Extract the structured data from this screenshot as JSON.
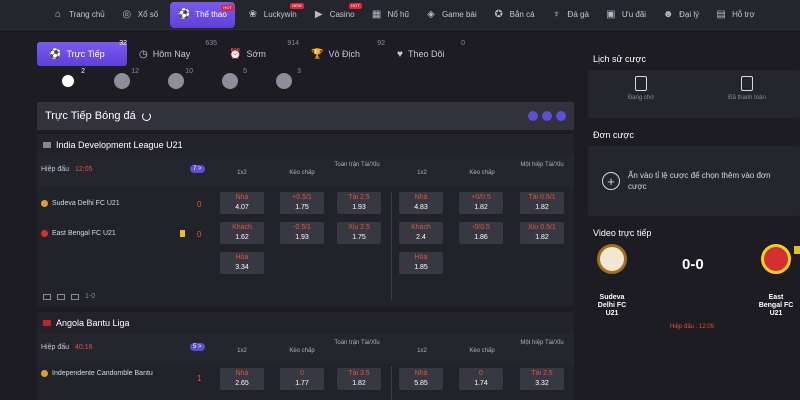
{
  "nav": [
    {
      "label": "Trang chủ",
      "icon": "home-icon",
      "glyph": "⌂"
    },
    {
      "label": "Xổ số",
      "icon": "lottery-icon",
      "glyph": "◎"
    },
    {
      "label": "Thể thao",
      "icon": "sports-icon",
      "glyph": "⚽",
      "hot": "HOT"
    },
    {
      "label": "Luckywin",
      "icon": "luckywin-icon",
      "glyph": "❀",
      "hot": "NEW"
    },
    {
      "label": "Casino",
      "icon": "casino-icon",
      "glyph": "▶",
      "hot": "HOT"
    },
    {
      "label": "Nổ hũ",
      "icon": "slots-icon",
      "glyph": "▦"
    },
    {
      "label": "Game bài",
      "icon": "cards-icon",
      "glyph": "◈"
    },
    {
      "label": "Bắn cá",
      "icon": "fish-icon",
      "glyph": "✪"
    },
    {
      "label": "Đá gà",
      "icon": "cockfight-icon",
      "glyph": "♆"
    },
    {
      "label": "Ưu đãi",
      "icon": "gift-icon",
      "glyph": "▣"
    },
    {
      "label": "Đại lý",
      "icon": "agent-icon",
      "glyph": "☻"
    },
    {
      "label": "Hỗ trợ",
      "icon": "support-icon",
      "glyph": "▤"
    }
  ],
  "tabs": [
    {
      "label": "Trực Tiếp",
      "count": "32",
      "glyph": "⚽"
    },
    {
      "label": "Hôm Nay",
      "count": "635",
      "glyph": "◷"
    },
    {
      "label": "Sớm",
      "count": "914",
      "glyph": "⏰"
    },
    {
      "label": "Vô Địch",
      "count": "92",
      "glyph": "🏆"
    },
    {
      "label": "Theo Dõi",
      "count": "0",
      "glyph": "♥"
    }
  ],
  "sports": [
    "2",
    "12",
    "10",
    "5",
    "3"
  ],
  "live_title": "Trực Tiếp Bóng đá",
  "columns": {
    "c1x2": "1x2",
    "handicap": "Kèo chấp",
    "ou_full": "Toàn trận Tài/Xỉu",
    "c1x2_h": "1x2",
    "handicap_h": "Kèo chấp",
    "ou_half": "Một hiệp Tài/Xỉu"
  },
  "leagues": [
    {
      "name": "India Development League U21",
      "period": "Hiệp đấu",
      "time": "12:05",
      "more": "7 >",
      "home": "Sudeva Delhi FC U21",
      "away": "East Bengal FC U21",
      "home_score": "0",
      "away_score": "0",
      "card": "1",
      "odds": {
        "x_home": [
          "Nhà",
          "4.07"
        ],
        "x_away": [
          "Khách",
          "1.62"
        ],
        "x_draw": [
          "Hòa",
          "3.34"
        ],
        "h_home": [
          "+0.5/1",
          "1.75"
        ],
        "h_away": [
          "-0.5/1",
          "1.93"
        ],
        "ou_over": [
          "Tài 2.5",
          "1.93"
        ],
        "ou_under": [
          "Xỉu 2.5",
          "1.75"
        ],
        "hx_home": [
          "Nhà",
          "4.83"
        ],
        "hx_away": [
          "Khách",
          "2.4"
        ],
        "hx_draw": [
          "Hòa",
          "1.85"
        ],
        "hh_home": [
          "+0/0.5",
          "1.82"
        ],
        "hh_away": [
          "-0/0.5",
          "1.86"
        ],
        "hou_over": [
          "Tài 0.5/1",
          "1.82"
        ],
        "hou_under": [
          "Xỉu 0.5/1",
          "1.82"
        ]
      },
      "extra": "1-0"
    },
    {
      "name": "Angola Bantu Liga",
      "period": "Hiệp đấu",
      "time": "40:16",
      "more": "5 >",
      "home": "Independente Candomble Bantu",
      "home_score": "1",
      "odds": {
        "x_home": [
          "Nhà",
          "2.65"
        ],
        "h_home": [
          "0",
          "1.77"
        ],
        "ou_over": [
          "Tài 3.5",
          "1.82"
        ],
        "hx_home": [
          "Nhà",
          "5.85"
        ],
        "hh_home": [
          "0",
          "1.74"
        ],
        "hou_over": [
          "Tài 2.5",
          "3.32"
        ]
      }
    }
  ],
  "right": {
    "history_title": "Lịch sử cược",
    "pending": "Đang chờ",
    "settled": "Đã thanh toán",
    "betslip_title": "Đơn cược",
    "betslip_msg": "Ấn vào tỉ lệ cược để chọn thêm vào đơn cược",
    "video_title": "Video trực tiếp",
    "home": "Sudeva Delhi FC U21",
    "away": "East Bengal FC U21",
    "score": "0-0",
    "time_label": "Hiệp đấu : 12:05"
  }
}
